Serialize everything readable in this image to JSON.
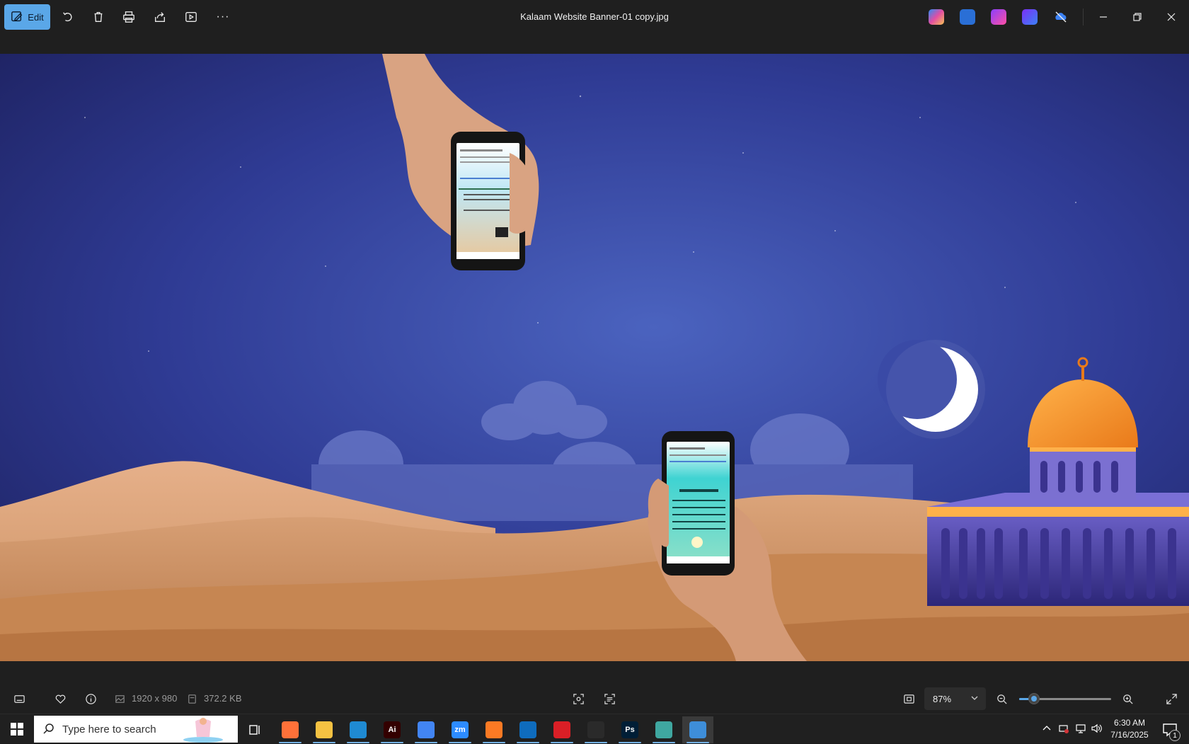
{
  "window": {
    "title": "Kalaam Website Banner-01 copy.jpg"
  },
  "toolbar": {
    "edit_label": "Edit",
    "more_label": "···"
  },
  "status": {
    "dimensions": "1920 x 980",
    "file_size": "372.2 KB",
    "zoom_level": "87%",
    "zoom_fraction": 0.16
  },
  "taskbar": {
    "search_placeholder": "Type here to search",
    "apps": [
      {
        "name": "Firefox",
        "color": "#ff7139",
        "glyph": ""
      },
      {
        "name": "File Explorer",
        "color": "#f5c242",
        "glyph": ""
      },
      {
        "name": "VS Code",
        "color": "#1f8ad2",
        "glyph": ""
      },
      {
        "name": "Illustrator",
        "color": "#330000",
        "glyph": "Ai"
      },
      {
        "name": "Chrome",
        "color": "#4285f4",
        "glyph": ""
      },
      {
        "name": "Zoom",
        "color": "#2d8cff",
        "glyph": "zm"
      },
      {
        "name": "XAMPP",
        "color": "#fb7a24",
        "glyph": ""
      },
      {
        "name": "Outlook",
        "color": "#0f6cbd",
        "glyph": ""
      },
      {
        "name": "Creative Cloud",
        "color": "#da1f26",
        "glyph": ""
      },
      {
        "name": "Pen tool",
        "color": "#2a2a2a",
        "glyph": ""
      },
      {
        "name": "Photoshop",
        "color": "#001e36",
        "glyph": "Ps"
      },
      {
        "name": "App",
        "color": "#3fa7a0",
        "glyph": ""
      },
      {
        "name": "Photos",
        "color": "#3e8ed9",
        "glyph": ""
      }
    ],
    "clock_time": "6:30 AM",
    "clock_date": "7/16/2025",
    "notification_count": "1"
  },
  "colors": {
    "accent": "#5aa7e8",
    "sky_top": "#1f2566",
    "sky_mid": "#3a4ea8",
    "sand": "#d9a06e"
  }
}
